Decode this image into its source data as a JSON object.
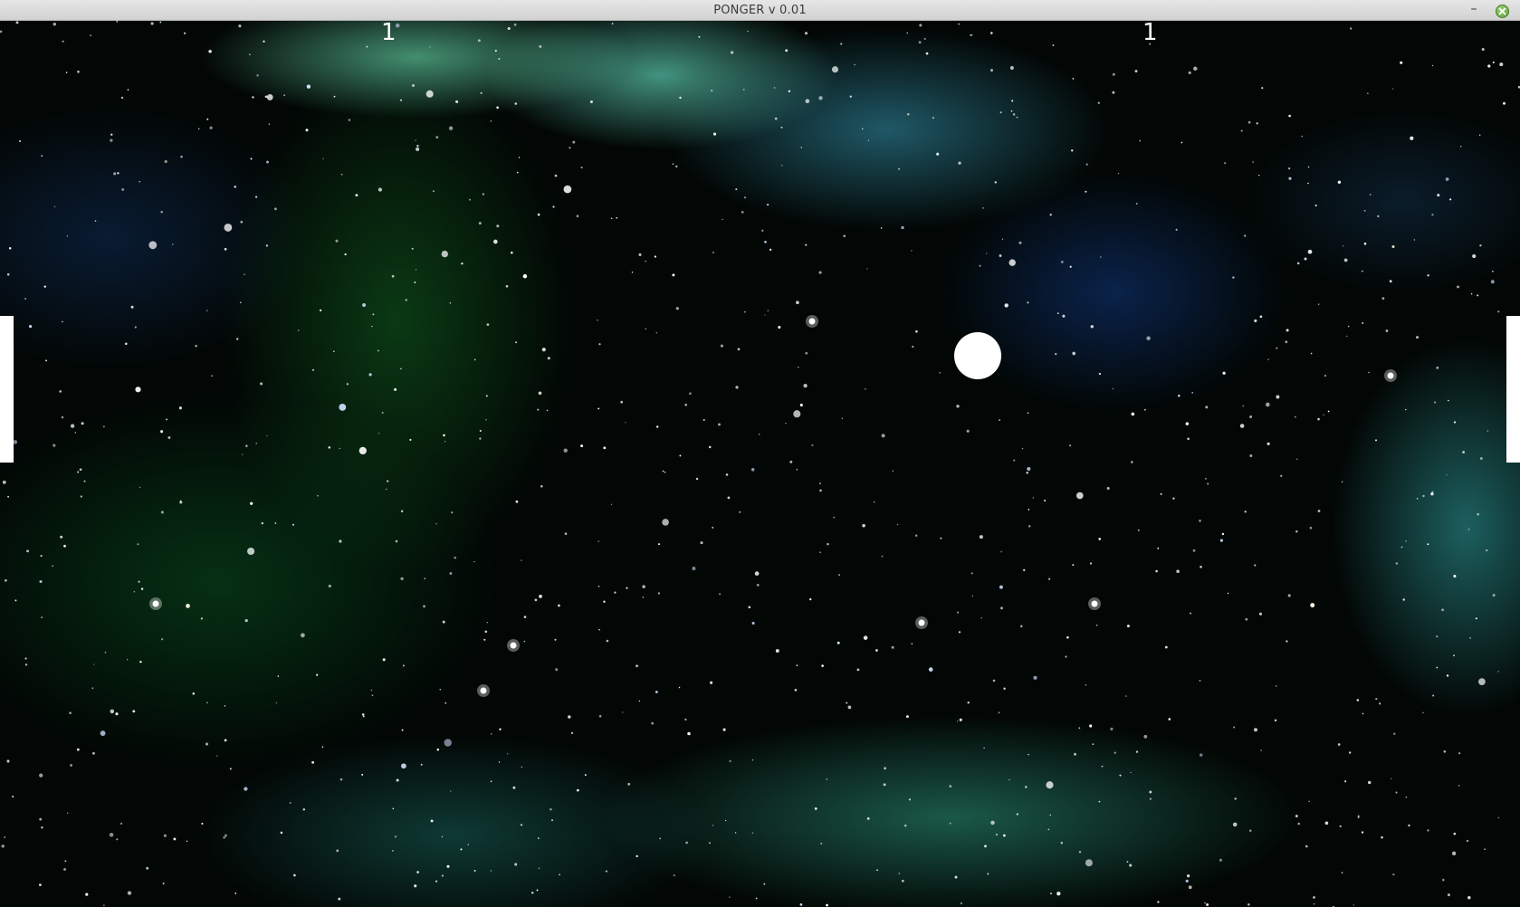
{
  "window": {
    "title": "PONGER v 0.01",
    "minimize_symbol": "–"
  },
  "game": {
    "background": "starfield-nebula",
    "score_left": "1",
    "score_right": "1"
  },
  "colors": {
    "paddle": "#ffffff",
    "ball": "#ffffff",
    "close_button": "#6aaa40"
  }
}
